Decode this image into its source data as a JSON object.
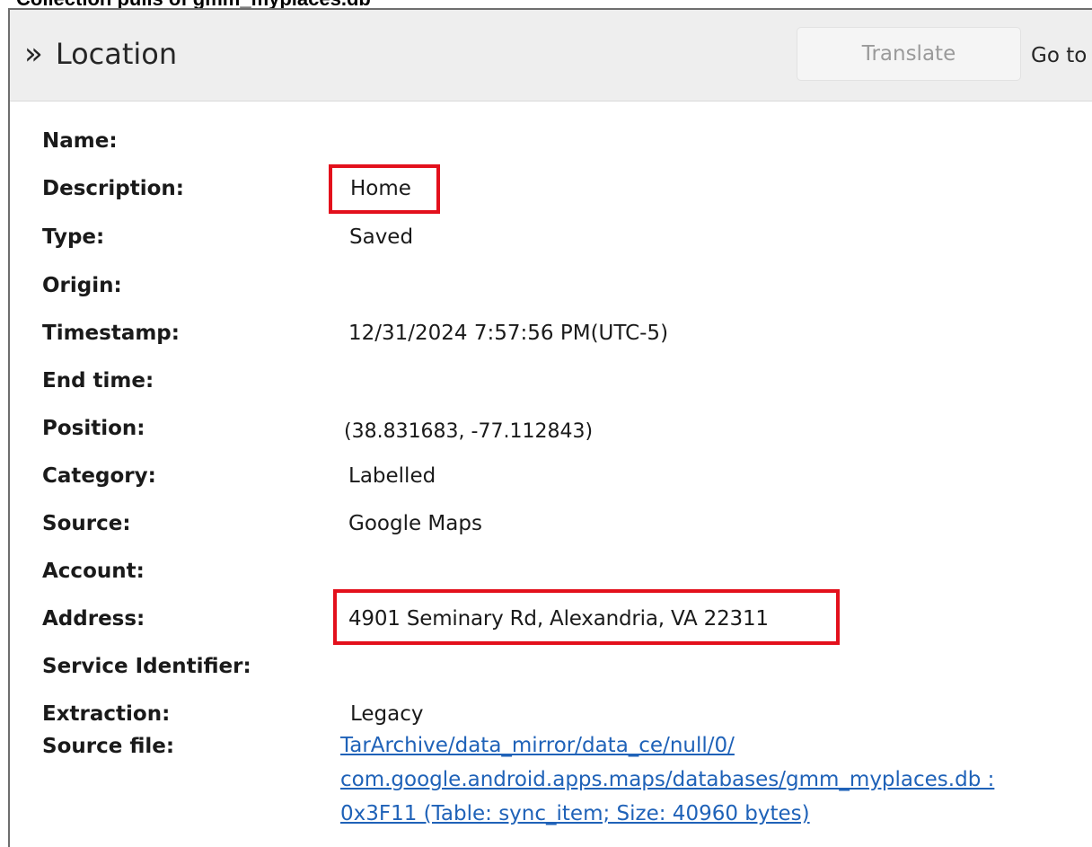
{
  "caption": "Collection pulls of gmm_myplaces.db",
  "header": {
    "title": "Location",
    "chevron_glyph": "»",
    "expand_icon": "double-chevron-right-icon",
    "translate_label": "Translate",
    "goto_label": "Go to"
  },
  "fields": [
    {
      "key": "name",
      "label": "Name:",
      "value": ""
    },
    {
      "key": "description",
      "label": "Description:",
      "value": "Home"
    },
    {
      "key": "type",
      "label": "Type:",
      "value": "Saved"
    },
    {
      "key": "origin",
      "label": "Origin:",
      "value": ""
    },
    {
      "key": "timestamp",
      "label": "Timestamp:",
      "value": "12/31/2024 7:57:56 PM(UTC-5)"
    },
    {
      "key": "end_time",
      "label": "End time:",
      "value": ""
    },
    {
      "key": "position",
      "label": "Position:",
      "value": "(38.831683, -77.112843)"
    },
    {
      "key": "category",
      "label": "Category:",
      "value": "Labelled"
    },
    {
      "key": "source",
      "label": "Source:",
      "value": "Google Maps"
    },
    {
      "key": "account",
      "label": "Account:",
      "value": ""
    },
    {
      "key": "address",
      "label": "Address:",
      "value": "4901 Seminary Rd, Alexandria, VA 22311"
    },
    {
      "key": "service_identifier",
      "label": "Service Identifier:",
      "value": ""
    },
    {
      "key": "extraction",
      "label": "Extraction:",
      "value": "Legacy"
    },
    {
      "key": "source_file",
      "label": "Source file:",
      "value": ""
    }
  ],
  "source_file_link": [
    "TarArchive/data_mirror/data_ce/null/0/",
    "com.google.android.apps.maps/databases/gmm_myplaces.db :",
    "0x3F11 (Table: sync_item; Size: 40960 bytes)"
  ],
  "colors": {
    "highlight": "#e3101c",
    "link": "#1f62b8",
    "header_bg": "#eeeeee"
  }
}
